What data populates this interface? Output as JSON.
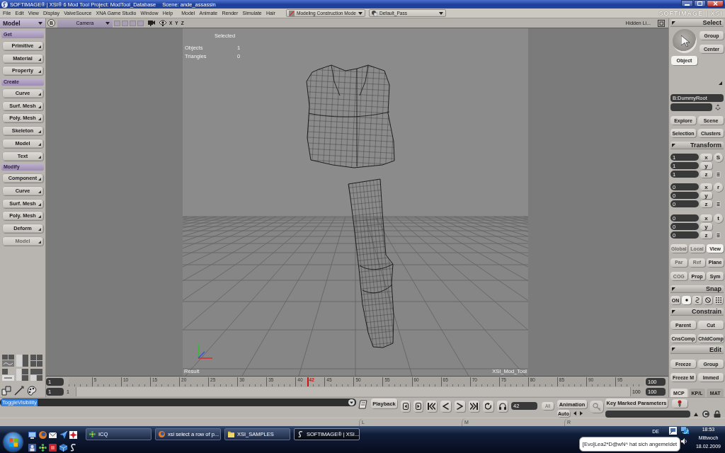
{
  "window": {
    "title": "SOFTIMAGE® | XSI® 6 Mod Tool Project: ModTool_Database",
    "scene": "Scene: ande_assassin"
  },
  "menu_bar": {
    "menus": [
      "File",
      "Edit",
      "View",
      "Display",
      "ValveSource",
      "XNA Game Studio",
      "Window",
      "Help"
    ],
    "modules": [
      "Model",
      "Animate",
      "Render",
      "Simulate",
      "Hair"
    ],
    "mode_dropdown": "Modeling Construction Mode",
    "pass_dropdown": "Default_Pass",
    "logo": "SOFTIMAGE | XSI"
  },
  "layout_dropdown": "Model",
  "viewport_header": {
    "view_button": "B",
    "camera_dropdown": "Camera",
    "axes": [
      "X",
      "Y",
      "Z"
    ],
    "hidden_label": "Hidden Li..."
  },
  "left_panel": {
    "sections": [
      {
        "title": "Get",
        "buttons": [
          {
            "label": "Primitive",
            "disabled": false
          },
          {
            "label": "Material",
            "disabled": false
          },
          {
            "label": "Property",
            "disabled": false
          }
        ]
      },
      {
        "title": "Create",
        "buttons": [
          {
            "label": "Curve",
            "disabled": false
          },
          {
            "label": "Surf. Mesh",
            "disabled": false
          },
          {
            "label": "Poly. Mesh",
            "disabled": false
          },
          {
            "label": "Skeleton",
            "disabled": false
          },
          {
            "label": "Model",
            "disabled": false
          },
          {
            "label": "Text",
            "disabled": false
          }
        ]
      },
      {
        "title": "Modify",
        "buttons": [
          {
            "label": "Component",
            "disabled": false
          },
          {
            "label": "Curve",
            "disabled": false
          },
          {
            "label": "Surf. Mesh",
            "disabled": false
          },
          {
            "label": "Poly. Mesh",
            "disabled": false
          },
          {
            "label": "Deform",
            "disabled": false
          },
          {
            "label": "Model",
            "disabled": true
          }
        ]
      }
    ]
  },
  "viewport": {
    "info_title": "Selected",
    "stats": [
      {
        "label": "Objects",
        "value": "1"
      },
      {
        "label": "Triangles",
        "value": "0"
      }
    ],
    "left_caption": "Result",
    "right_caption": "XSI_Mod_Tool"
  },
  "timeline": {
    "start_fields": [
      "1",
      "1"
    ],
    "start_label": "1",
    "ticks": [
      "5",
      "10",
      "15",
      "20",
      "25",
      "30",
      "35",
      "40",
      "45",
      "50",
      "55",
      "60",
      "65",
      "70",
      "75",
      "80",
      "85",
      "90",
      "95"
    ],
    "current_frame": {
      "label": "42",
      "level": 0.414
    },
    "end_label": "100",
    "end_fields": [
      "100",
      "100"
    ]
  },
  "right_panel": {
    "select": {
      "title": "Select",
      "buttons": [
        "Group",
        "Center"
      ],
      "object_button": {
        "label": "Object",
        "selected": true
      },
      "name_field": "B:DummyRoot",
      "browse_buttons": [
        "Explore",
        "Scene",
        "Selection",
        "Clusters"
      ]
    },
    "transform": {
      "title": "Transform",
      "groups": [
        {
          "button": "S",
          "rows": [
            {
              "value": "1",
              "axis": "x"
            },
            {
              "value": "1",
              "axis": "y"
            },
            {
              "value": "1",
              "axis": "z"
            }
          ]
        },
        {
          "button": "r",
          "rows": [
            {
              "value": "0",
              "axis": "x"
            },
            {
              "value": "0",
              "axis": "y"
            },
            {
              "value": "0",
              "axis": "z"
            }
          ]
        },
        {
          "button": "t",
          "rows": [
            {
              "value": "0",
              "axis": "x"
            },
            {
              "value": "0",
              "axis": "y"
            },
            {
              "value": "0",
              "axis": "z"
            }
          ]
        }
      ],
      "modes": [
        {
          "label": "Global",
          "disabled": true,
          "selected": false
        },
        {
          "label": "Local",
          "disabled": true,
          "selected": false
        },
        {
          "label": "View",
          "disabled": false,
          "selected": true
        },
        {
          "label": "Par",
          "disabled": true,
          "selected": false
        },
        {
          "label": "Ref",
          "disabled": true,
          "selected": false
        },
        {
          "label": "Plane",
          "disabled": false,
          "selected": false
        },
        {
          "label": "COG",
          "disabled": true,
          "selected": false
        },
        {
          "label": "Prop",
          "disabled": false,
          "selected": false
        },
        {
          "label": "Sym",
          "disabled": false,
          "selected": false
        }
      ]
    },
    "snap": {
      "title": "Snap",
      "on_button": "ON",
      "options": [
        {
          "kind": "point",
          "selected": true
        },
        {
          "kind": "curve",
          "selected": false
        },
        {
          "kind": "ring",
          "selected": false
        },
        {
          "kind": "grid",
          "selected": false
        }
      ]
    },
    "constrain": {
      "title": "Constrain",
      "buttons": [
        "Parent",
        "Cut",
        "CnsComp",
        "ChldComp"
      ]
    },
    "edit": {
      "title": "Edit",
      "buttons": [
        "Freeze",
        "Group",
        "Freeze M",
        "Immed"
      ]
    },
    "tabs": [
      {
        "label": "MCP",
        "selected": true
      },
      {
        "label": "KP/L",
        "selected": false
      },
      {
        "label": "MAT",
        "selected": false
      }
    ]
  },
  "command_bar": {
    "command": "ToggleVisibility",
    "selected": true
  },
  "playback": {
    "playback_button": "Playback",
    "frame": "42",
    "all_button": "All",
    "animation_button": "Animation",
    "auto_button": "Auto"
  },
  "key_panel": {
    "button": "Key Marked Parameters"
  },
  "mouse_status": [
    "L",
    "M",
    "R"
  ],
  "taskbar": {
    "tasks": [
      {
        "label": "ICQ",
        "kind": "icq",
        "selected": false
      },
      {
        "label": "xsi select a row of p...",
        "kind": "browser",
        "selected": false
      },
      {
        "label": "XSI_SAMPLES",
        "kind": "folder",
        "selected": false
      },
      {
        "label": "SOFTIMAGE® | XSI...",
        "kind": "softimage",
        "selected": true
      }
    ],
    "language": "DE",
    "clock": {
      "time": "18:53",
      "day": "Mittwoch",
      "date": "18.02.2009"
    },
    "notification": "[Evo]Lea2*D@wN^ hat sich angemeldet"
  }
}
